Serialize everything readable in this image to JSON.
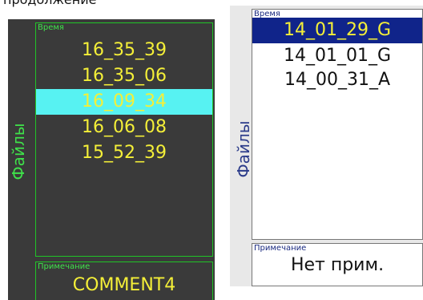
{
  "top_cut_text": "продолжение",
  "dark_panel": {
    "side_label": "Файлы",
    "list_label": "Время",
    "rows": [
      "16_35_39",
      "16_35_06",
      "16_09_34",
      "16_06_08",
      "15_52_39"
    ],
    "selected_index": 2,
    "note_label": "Примечание",
    "note_value": "COMMENT4"
  },
  "light_panel": {
    "side_label": "Файлы",
    "list_label": "Время",
    "rows": [
      "14_01_29_G",
      "14_01_01_G",
      "14_00_31_A"
    ],
    "selected_index": 0,
    "note_label": "Примечание",
    "note_value": "Нет прим."
  },
  "colors": {
    "dark_bg": "#3a3a3a",
    "dark_text": "#f4ef38",
    "dark_accent": "#3fe24a",
    "dark_selection": "#57f2f2",
    "light_selection": "#10248a",
    "light_label": "#1a2a80"
  }
}
